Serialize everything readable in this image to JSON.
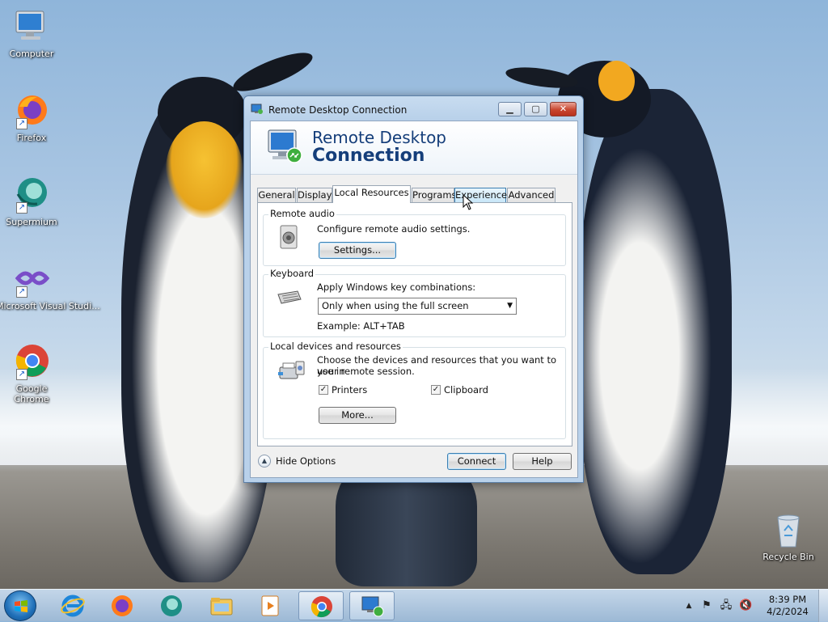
{
  "desktop": {
    "icons": [
      {
        "label": "Computer",
        "icon": "computer-icon"
      },
      {
        "label": "Firefox",
        "icon": "firefox-icon"
      },
      {
        "label": "Supermium",
        "icon": "supermium-icon"
      },
      {
        "label": "Microsoft Visual Studi...",
        "icon": "visual-studio-icon"
      },
      {
        "label": "Google Chrome",
        "icon": "chrome-icon"
      },
      {
        "label": "Recycle Bin",
        "icon": "recycle-bin-icon"
      }
    ]
  },
  "window": {
    "title": "Remote Desktop Connection",
    "banner_line1": "Remote Desktop",
    "banner_line2": "Connection",
    "tabs": [
      {
        "label": "General"
      },
      {
        "label": "Display"
      },
      {
        "label": "Local Resources",
        "active": true
      },
      {
        "label": "Programs"
      },
      {
        "label": "Experience",
        "hover": true
      },
      {
        "label": "Advanced"
      }
    ],
    "remote_audio": {
      "title": "Remote audio",
      "description": "Configure remote audio settings.",
      "settings_button": "Settings..."
    },
    "keyboard": {
      "title": "Keyboard",
      "description": "Apply Windows key combinations:",
      "selected_option": "Only when using the full screen",
      "example": "Example: ALT+TAB"
    },
    "local_devices": {
      "title": "Local devices and resources",
      "description_line1": "Choose the devices and resources that you want to use in",
      "description_line2": "your remote session.",
      "printers_label": "Printers",
      "printers_checked": true,
      "clipboard_label": "Clipboard",
      "clipboard_checked": true,
      "more_button": "More..."
    },
    "hide_options": "Hide Options",
    "connect_button": "Connect",
    "help_button": "Help"
  },
  "taskbar": {
    "pinned": [
      "internet-explorer-icon",
      "firefox-icon",
      "supermium-icon",
      "file-explorer-icon",
      "media-player-icon",
      "chrome-icon",
      "remote-desktop-icon"
    ],
    "clock_time": "8:39 PM",
    "clock_date": "4/2/2024"
  }
}
